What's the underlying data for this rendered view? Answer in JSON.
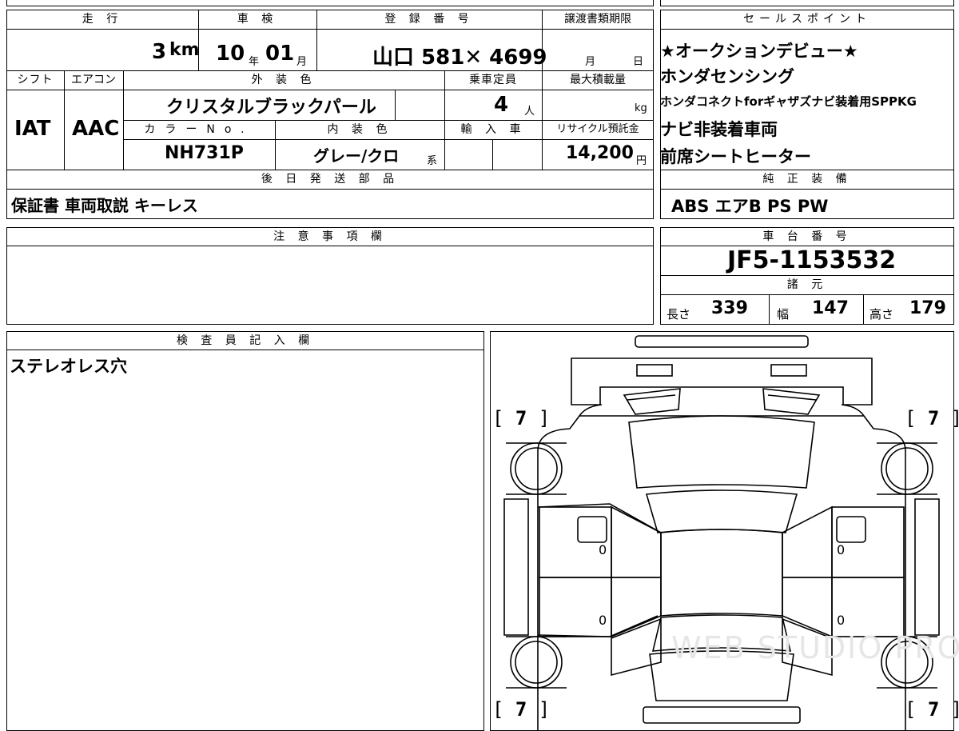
{
  "vehicle": {
    "mileage_header": "走 行",
    "mileage_value": "3",
    "mileage_unit": "km",
    "inspection_header": "車 検",
    "inspection_year": "10",
    "inspection_year_unit": "年",
    "inspection_month": "01",
    "inspection_month_unit": "月",
    "registration_header": "登 録 番 号",
    "registration_value": "山口 581✕ 4699",
    "transfer_header": "譲渡書類期限",
    "transfer_month_unit": "月",
    "transfer_day_unit": "日",
    "shift_header": "シフト",
    "shift_value": "IAT",
    "aircon_header": "エアコン",
    "aircon_value": "AAC",
    "exterior_color_header": "外 装 色",
    "exterior_color_value": "クリスタルブラックパール",
    "capacity_header": "乗車定員",
    "capacity_value": "4",
    "capacity_unit": "人",
    "max_load_header": "最大積載量",
    "max_load_unit": "kg",
    "color_no_header": "カラーNo.",
    "color_no_value": "NH731P",
    "interior_color_header": "内 装 色",
    "interior_color_value": "グレー/クロ",
    "interior_suffix": "系",
    "import_header": "輸 入 車",
    "recycle_header": "リサイクル預託金",
    "recycle_value": "14,200",
    "recycle_unit": "円",
    "later_parts_header": "後 日 発 送 部 品",
    "later_parts_value": "保証書 車両取説 キーレス"
  },
  "sales_points": {
    "header": "セールスポイント",
    "items": [
      "★オークションデビュー★",
      "ホンダセンシング",
      "ホンダコネクトforギャザズナビ装着用SPPKG",
      "ナビ非装着車両",
      "前席シートヒーター"
    ]
  },
  "equipment": {
    "header": "純 正 装 備",
    "value": "ABS エアB PS PW"
  },
  "notes": {
    "header": "注 意 事 項 欄",
    "value": ""
  },
  "chassis": {
    "header": "車 台 番 号",
    "value": "JF5-1153532"
  },
  "specs": {
    "header": "諸 元",
    "length_label": "長さ",
    "length_value": "339",
    "width_label": "幅",
    "width_value": "147",
    "height_label": "高さ",
    "height_value": "179"
  },
  "inspector": {
    "header": "検 査 員 記 入 欄",
    "value": "ステレオレス穴"
  },
  "diagram": {
    "tire_tl": "7",
    "tire_tr": "7",
    "tire_bl": "7",
    "tire_br": "7",
    "door_fl": "0",
    "door_fr": "0",
    "door_rl": "0",
    "door_rr": "0",
    "watermark": "WEB STUDIO PRO"
  }
}
